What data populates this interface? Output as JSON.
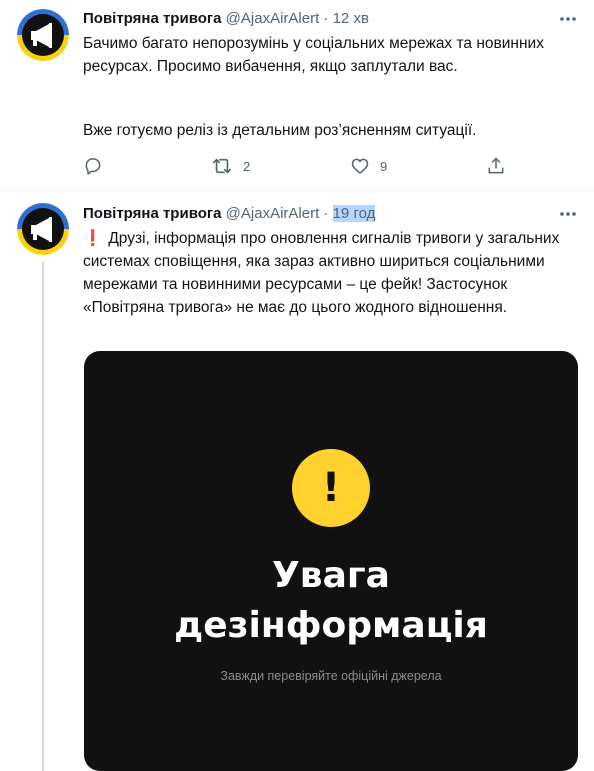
{
  "colors": {
    "text": "#0f1419",
    "secondary": "#536471",
    "separator": "#eff3f4",
    "thread_line": "#cfd9de",
    "time_highlight": "#b4d5fe",
    "avatar_blue": "#2f6fd0",
    "avatar_yellow": "#f9d10f",
    "card_background": "#111111",
    "warning_yellow": "#ffd22e"
  },
  "tweets": [
    {
      "avatar_icon": "megaphone-icon",
      "name": "Повітряна тривога",
      "handle": "@AjaxAirAlert",
      "dot": "·",
      "time": "12 хв",
      "more_icon": "more-icon",
      "paragraphs": [
        "Бачимо багато непорозумінь у соціальних мережах та новинних ресурсах. Просимо вибачення, якщо заплутали вас.",
        "Вже готуємо реліз із детальним роз’ясненням ситуації."
      ],
      "actions": {
        "reply": {
          "icon": "reply-icon",
          "count": ""
        },
        "retweet": {
          "icon": "retweet-icon",
          "count": "2"
        },
        "like": {
          "icon": "heart-icon",
          "count": "9"
        },
        "share": {
          "icon": "share-icon",
          "count": ""
        }
      }
    },
    {
      "avatar_icon": "megaphone-icon",
      "name": "Повітряна тривога",
      "handle": "@AjaxAirAlert",
      "dot": "·",
      "time": "19 год",
      "more_icon": "more-icon",
      "emoji": "❗",
      "text": "Друзі, інформація про оновлення сигналів тривоги у загальних системах сповіщення, яка зараз активно шириться соціальними мережами та новинними ресурсами – це фейк! Застосунок «Повітряна тривога» не має до цього жодного відношення.",
      "card": {
        "warning_symbol": "!",
        "title_line1": "Увага",
        "title_line2": "дезінформація",
        "subtitle": "Завжди перевіряйте офіційні джерела"
      }
    }
  ]
}
